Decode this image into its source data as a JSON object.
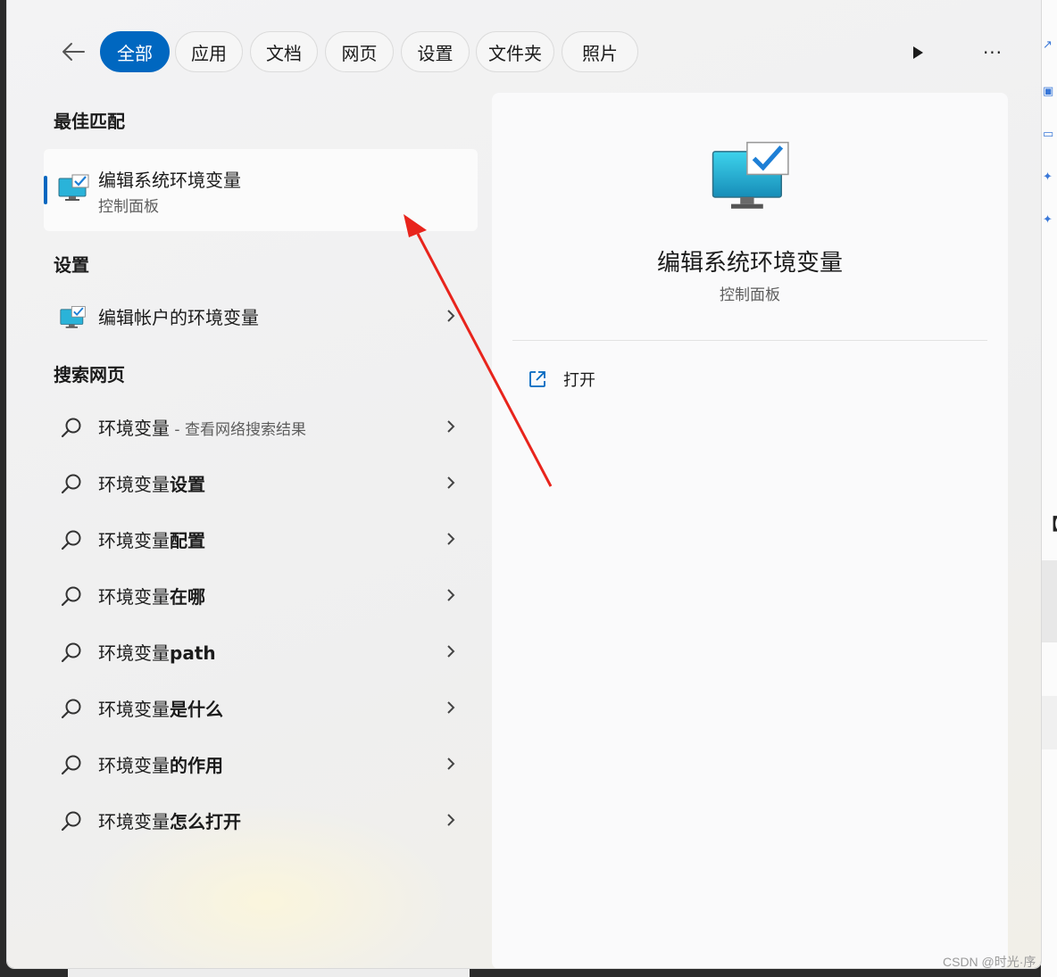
{
  "filters": {
    "items": [
      "全部",
      "应用",
      "文档",
      "网页",
      "设置",
      "文件夹",
      "照片"
    ],
    "active_index": 0
  },
  "icons": {
    "back": "arrow-left-icon",
    "play": "play-icon",
    "more": "more-horizontal-icon",
    "app": "monitor-checkmark-icon",
    "search": "search-icon",
    "chevron": "chevron-right-icon",
    "open": "open-external-icon"
  },
  "more_label": "···",
  "best_match": {
    "heading": "最佳匹配",
    "title": "编辑系统环境变量",
    "subtitle": "控制面板"
  },
  "settings": {
    "heading": "设置",
    "item": "编辑帐户的环境变量"
  },
  "web": {
    "heading": "搜索网页",
    "first": {
      "base": "环境变量",
      "hint": " - 查看网络搜索结果"
    },
    "items": [
      {
        "base": "环境变量",
        "bold": "设置"
      },
      {
        "base": "环境变量",
        "bold": "配置"
      },
      {
        "base": "环境变量",
        "bold": "在哪"
      },
      {
        "base": "环境变量",
        "bold": "path"
      },
      {
        "base": "环境变量",
        "bold": "是什么"
      },
      {
        "base": "环境变量",
        "bold": "的作用"
      },
      {
        "base": "环境变量",
        "bold": "怎么打开"
      }
    ]
  },
  "preview": {
    "title": "编辑系统环境变量",
    "subtitle": "控制面板",
    "open_label": "打开"
  },
  "background": {
    "bracket": "【"
  },
  "watermark": "CSDN @时光·序",
  "colors": {
    "accent": "#0067c0",
    "annotation_arrow": "#e8241c"
  }
}
